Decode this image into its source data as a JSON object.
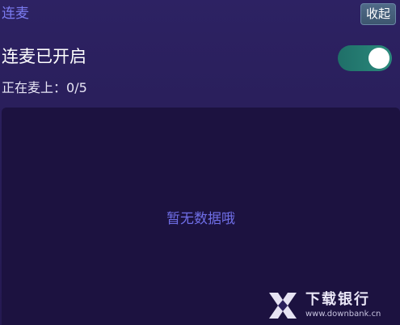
{
  "header": {
    "title": "连麦",
    "collapse_label": "收起"
  },
  "status": {
    "label": "连麦已开启",
    "toggle_on": true,
    "count_label": "正在麦上：",
    "count_value": "0/5"
  },
  "list": {
    "empty_text": "暂无数据哦"
  },
  "watermark": {
    "title": "下载银行",
    "url": "www.downbank.cn"
  },
  "colors": {
    "accent_text": "#7b7bf0",
    "toggle_on": "#2b8a7c",
    "panel_bg": "#2a1f5c",
    "list_bg": "#1c1240"
  }
}
